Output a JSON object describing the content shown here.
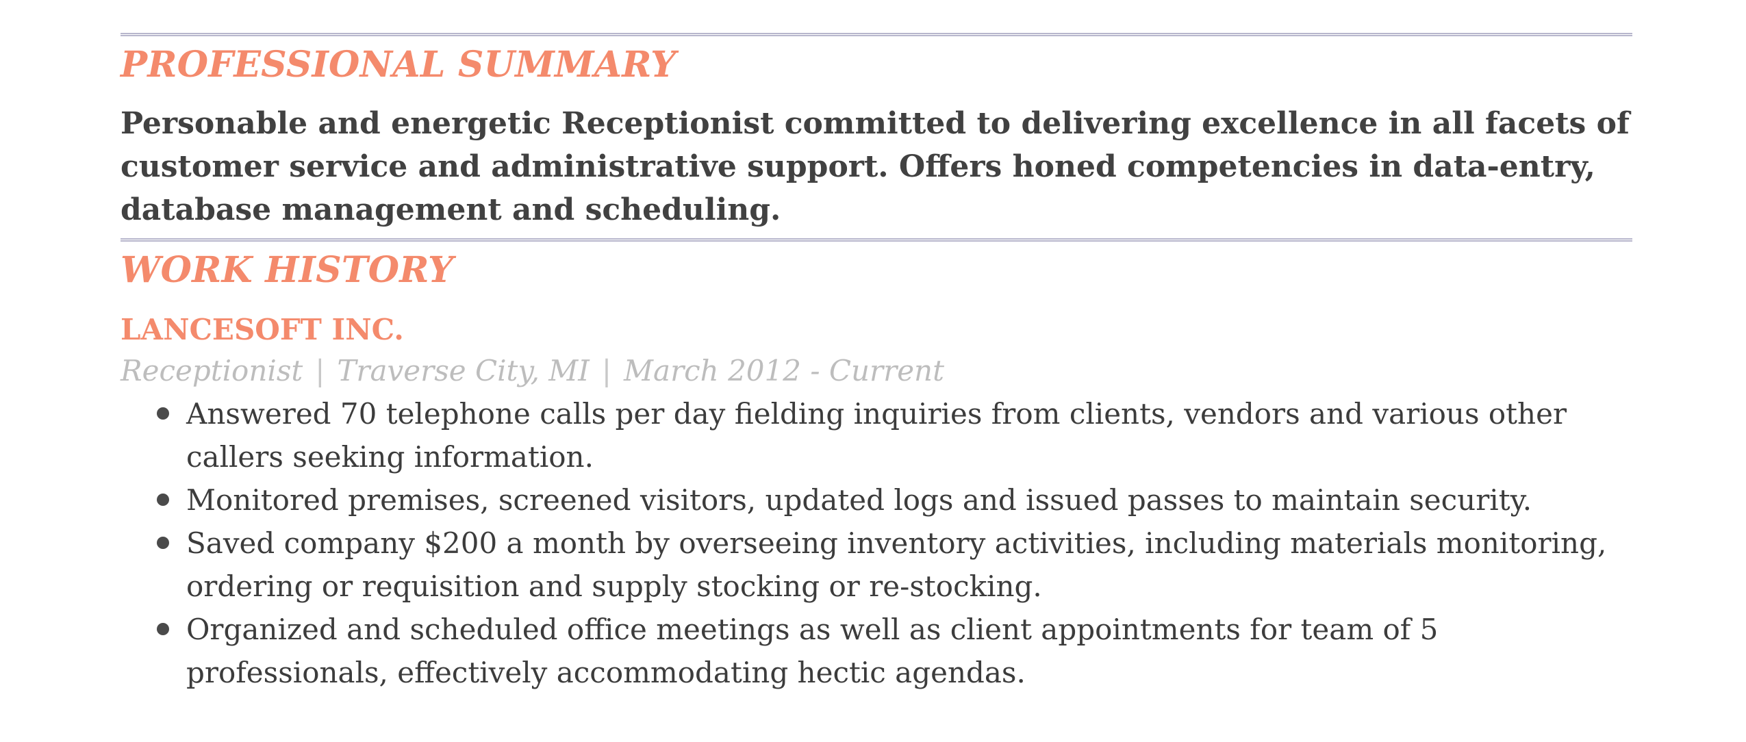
{
  "summary_section": {
    "heading": "PROFESSIONAL SUMMARY",
    "text": "Personable and energetic Receptionist committed to delivering excellence in all facets of customer service and administrative support. Offers honed competencies in data-entry, database management and scheduling."
  },
  "work_history_section": {
    "heading": "WORK HISTORY",
    "jobs": [
      {
        "company": "LANCESOFT INC.",
        "title": "Receptionist",
        "location": "Traverse City, MI",
        "dates": "March 2012 - Current",
        "separator": "|",
        "bullets": [
          "Answered 70 telephone calls per day fielding inquiries from clients, vendors and various other callers seeking information.",
          "Monitored premises, screened visitors, updated logs and issued passes to maintain security.",
          "Saved company $200 a month by overseeing inventory activities, including materials monitoring, ordering or requisition and supply stocking or re-stocking.",
          "Organized and scheduled office meetings as well as client appointments for team of 5 professionals, effectively accommodating hectic agendas."
        ]
      }
    ]
  },
  "colors": {
    "accent": "#f48a6c",
    "rule": "#b7b6cc",
    "body_text": "#3c3c3c",
    "meta_text": "#bdbdbd"
  }
}
